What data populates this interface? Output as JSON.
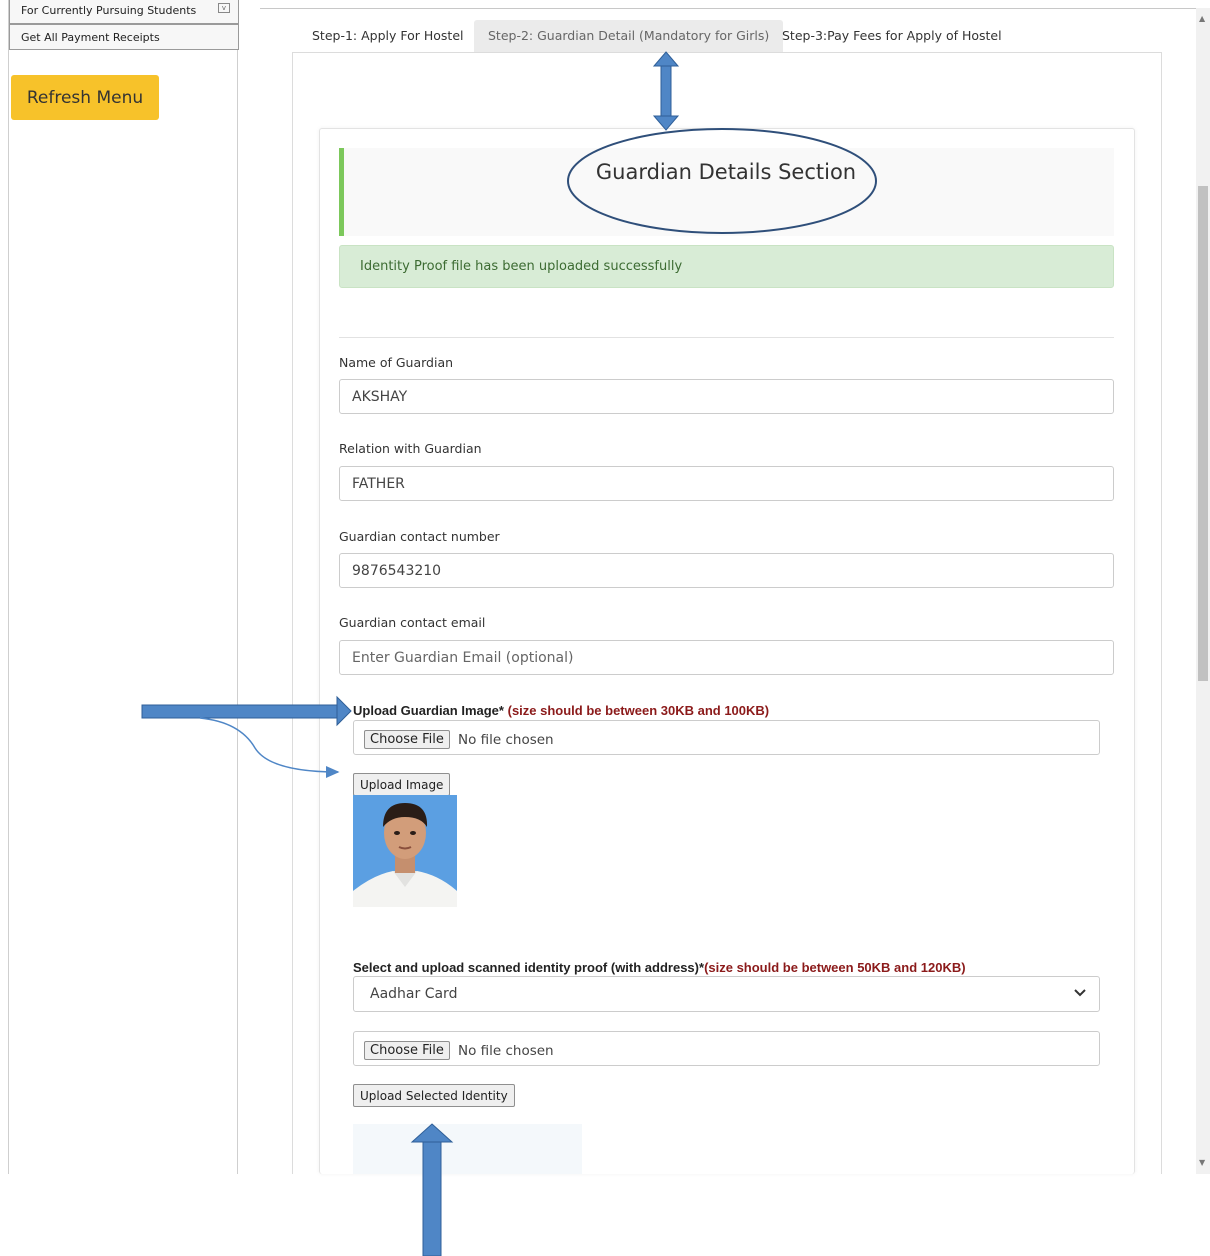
{
  "sidebar": {
    "items": [
      {
        "label": "For Currently Pursuing Students"
      },
      {
        "label": "Get All Payment Receipts"
      }
    ],
    "refresh_label": "Refresh Menu"
  },
  "tabs": [
    {
      "label": "Step-1: Apply For Hostel",
      "active": false
    },
    {
      "label": "Step-2: Guardian Detail (Mandatory for Girls)",
      "active": true
    },
    {
      "label": "Step-3:Pay Fees for Apply of Hostel",
      "active": false
    }
  ],
  "section": {
    "title": "Guardian Details Section",
    "alert": "Identity Proof file has been uploaded successfully"
  },
  "form": {
    "guardian_name": {
      "label": "Name of Guardian",
      "value": "AKSHAY"
    },
    "relation": {
      "label": "Relation with Guardian",
      "value": "FATHER"
    },
    "contact_number": {
      "label": "Guardian contact number",
      "value": "9876543210"
    },
    "contact_email": {
      "label": "Guardian contact email",
      "value": "",
      "placeholder": "Enter Guardian Email (optional)"
    },
    "guardian_image": {
      "label": "Upload Guardian Image*",
      "note": "(size should be between 30KB and 100KB)",
      "choose_label": "Choose File",
      "file_status": "No file chosen",
      "upload_label": "Upload Image"
    },
    "identity_proof": {
      "label": "Select and upload scanned identity proof (with address)*",
      "note": "(size should be between 50KB and 120KB)",
      "selected": "Aadhar Card",
      "choose_label": "Choose File",
      "file_status": "No file chosen",
      "upload_label": "Upload Selected Identity"
    }
  },
  "colors": {
    "refresh_button": "#f7c22a",
    "section_accent": "#7cc85b",
    "alert_bg": "#d8ecd6",
    "alert_text": "#3c6b32",
    "note_text": "#8b1a1a",
    "annotation_arrow": "#4f86c6",
    "annotation_ellipse": "#2f4f7a"
  },
  "icons": {
    "select": "chevron-down-icon",
    "sidebar_toggle": "collapse-icon"
  }
}
